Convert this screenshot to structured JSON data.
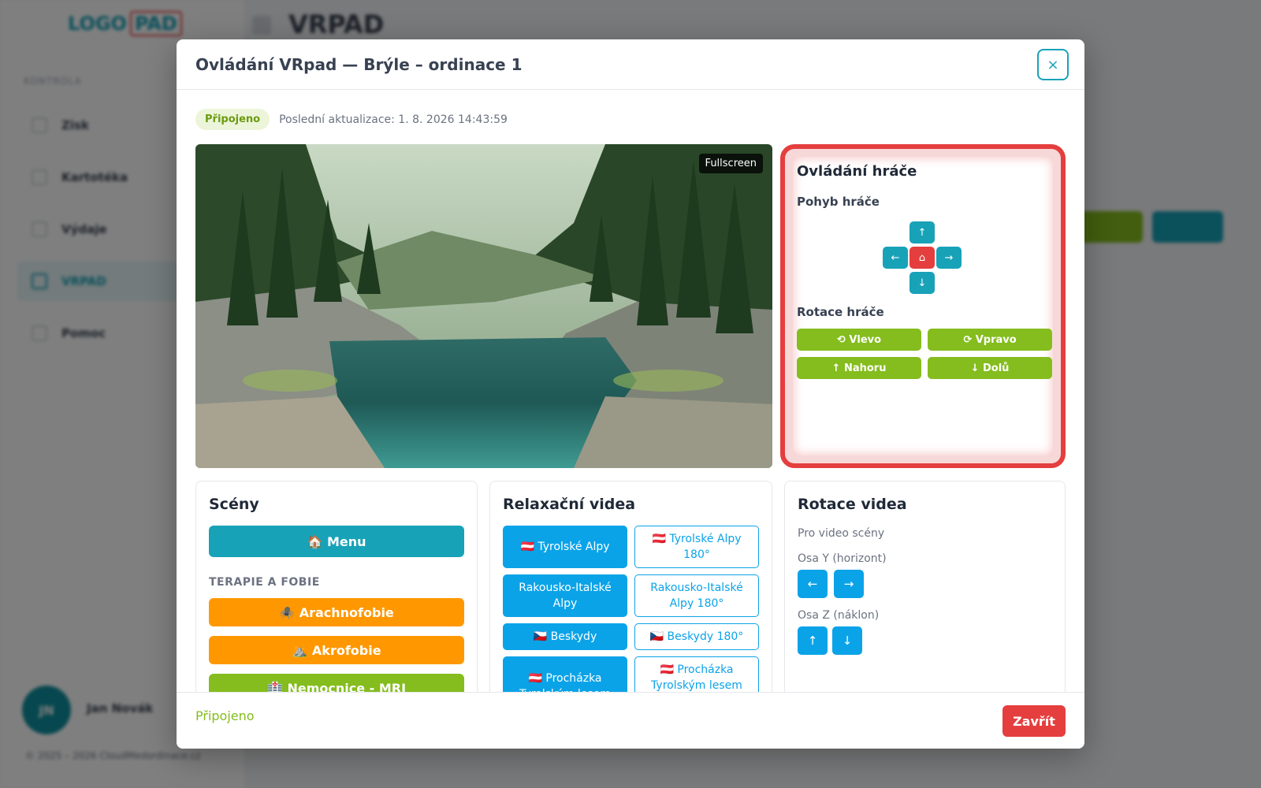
{
  "app": {
    "logo_text": "LOGO",
    "logo_pad": "PAD",
    "header_title": "VRPAD",
    "nav_section": "KONTROLA",
    "nav": [
      {
        "label": "Zisk"
      },
      {
        "label": "Kartotéka"
      },
      {
        "label": "Výdaje"
      },
      {
        "label": "VRPAD"
      },
      {
        "label": "Pomoc"
      }
    ],
    "user_initials": "JN",
    "user_name": "Jan Novák",
    "copyright": "© 2025 – 2026 CloudMedordinace.cz"
  },
  "modal": {
    "title": "Ovládání VRpad — Brýle – ordinace 1",
    "close_icon": "×",
    "status_badge": "Připojeno",
    "last_update": "Poslední aktualizace: 1. 8. 2026 14:43:59",
    "fullscreen_label": "Fullscreen",
    "player": {
      "title": "Ovládání hráče",
      "movement_title": "Pohyb hráče",
      "up": "↑",
      "left": "←",
      "home": "⌂",
      "right": "→",
      "down": "↓",
      "rotation_title": "Rotace hráče",
      "rot_left": "⟲ Vlevo",
      "rot_right": "⟳ Vpravo",
      "rot_up": "↑ Nahoru",
      "rot_down": "↓ Dolů"
    },
    "scenes": {
      "title": "Scény",
      "menu_button": "🏠 Menu",
      "category": "TERAPIE A FOBIE",
      "buttons": [
        "🕷️ Arachnofobie",
        "⛰️ Akrofobie",
        "🏥 Nemocnice - MRI"
      ]
    },
    "videos": {
      "title": "Relaxační videa",
      "items": [
        "🇦🇹 Tyrolské Alpy",
        "🇦🇹 Tyrolské Alpy 180°",
        "Rakousko-Italské Alpy",
        "Rakousko-Italské Alpy 180°",
        "🇨🇿 Beskydy",
        "🇨🇿 Beskydy 180°",
        "🇦🇹 Procházka Tyrolským lesem",
        "🇦🇹 Procházka Tyrolským lesem"
      ]
    },
    "video_rotation": {
      "title": "Rotace videa",
      "subtitle": "Pro video scény",
      "axis_y_label": "Osa Y (horizont)",
      "axis_z_label": "Osa Z (náklon)",
      "y_left": "←",
      "y_right": "→",
      "z_up": "↑",
      "z_down": "↓"
    },
    "footer_status": "Připojeno",
    "close_button": "Zavřít"
  },
  "colors": {
    "accent": "#17a2b8",
    "green": "#84bd1d",
    "orange": "#ff9800",
    "blue": "#0ba3e8",
    "red": "#e53e3e"
  }
}
